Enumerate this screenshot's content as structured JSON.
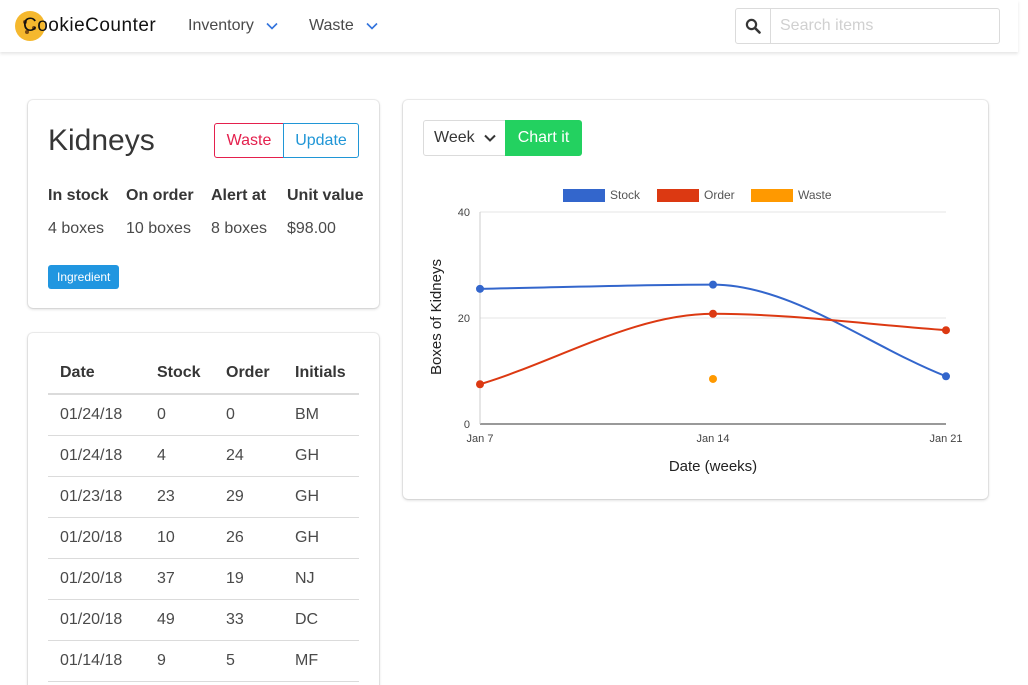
{
  "brand": {
    "name": "CookieCounter"
  },
  "nav": [
    {
      "label": "Inventory"
    },
    {
      "label": "Waste"
    }
  ],
  "search": {
    "placeholder": "Search items",
    "value": ""
  },
  "item": {
    "title": "Kidneys",
    "waste_label": "Waste",
    "update_label": "Update",
    "stats": [
      {
        "label": "In stock",
        "value": "4 boxes"
      },
      {
        "label": "On order",
        "value": "10 boxes"
      },
      {
        "label": "Alert at",
        "value": "8 boxes"
      },
      {
        "label": "Unit value",
        "value": "$98.00"
      }
    ],
    "tag": "Ingredient"
  },
  "log": {
    "headers": [
      "Date",
      "Stock",
      "Order",
      "Initials"
    ],
    "rows": [
      [
        "01/24/18",
        "0",
        "0",
        "BM"
      ],
      [
        "01/24/18",
        "4",
        "24",
        "GH"
      ],
      [
        "01/23/18",
        "23",
        "29",
        "GH"
      ],
      [
        "01/20/18",
        "10",
        "26",
        "GH"
      ],
      [
        "01/20/18",
        "37",
        "19",
        "NJ"
      ],
      [
        "01/20/18",
        "49",
        "33",
        "DC"
      ],
      [
        "01/14/18",
        "9",
        "5",
        "MF"
      ]
    ]
  },
  "chart_controls": {
    "period": "Week",
    "button": "Chart it"
  },
  "colors": {
    "stock": "#3366cc",
    "order": "#dc3912",
    "waste": "#ff9900",
    "tag": "#2196e0",
    "chart_button": "#23d160"
  },
  "chart_data": {
    "type": "line",
    "categories": [
      "Jan 7",
      "Jan 14",
      "Jan 21"
    ],
    "series": [
      {
        "name": "Stock",
        "values": [
          25.5,
          26.3,
          9
        ],
        "color": "#3366cc"
      },
      {
        "name": "Order",
        "values": [
          7.5,
          20.8,
          17.7
        ],
        "color": "#dc3912"
      },
      {
        "name": "Waste",
        "values": [
          null,
          8.5,
          null
        ],
        "color": "#ff9900"
      }
    ],
    "xlabel": "Date (weeks)",
    "ylabel": "Boxes of Kidneys",
    "yticks": [
      "0",
      "20",
      "40"
    ],
    "ylim": [
      0,
      40
    ],
    "smooth": true,
    "grid": true,
    "legend": "top"
  }
}
